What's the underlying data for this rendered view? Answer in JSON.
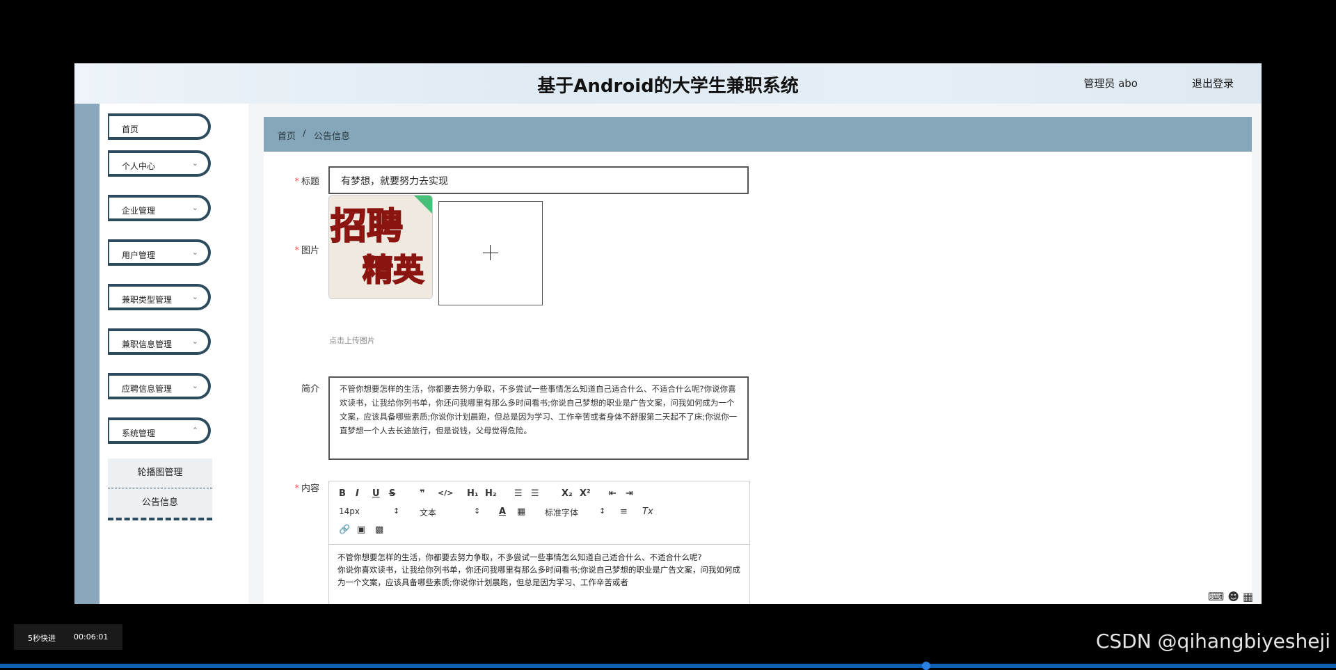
{
  "header": {
    "title": "基于Android的大学生兼职系统",
    "user": "管理员 abo",
    "logout": "退出登录"
  },
  "sidebar": {
    "items": [
      {
        "label": "首页"
      },
      {
        "label": "个人中心"
      },
      {
        "label": "企业管理"
      },
      {
        "label": "用户管理"
      },
      {
        "label": "兼职类型管理"
      },
      {
        "label": "兼职信息管理"
      },
      {
        "label": "应聘信息管理"
      },
      {
        "label": "系统管理"
      }
    ],
    "subitems": [
      {
        "label": "轮播图管理"
      },
      {
        "label": "公告信息"
      }
    ]
  },
  "breadcrumb": {
    "home": "首页",
    "sep": "/",
    "current": "公告信息"
  },
  "form": {
    "title_label": "标题",
    "title_value": "有梦想，就要努力去实现",
    "image_label": "图片",
    "image_text_line1": "招聘",
    "image_text_line2": "精英",
    "upload_tip": "点击上传图片",
    "intro_label": "简介",
    "intro_value": "不管你想要怎样的生活，你都要去努力争取，不多尝试一些事情怎么知道自己适合什么、不适合什么呢?你说你喜欢读书，让我给你列书单，你还问我哪里有那么多时间看书;你说自己梦想的职业是广告文案，问我如何成为一个文案，应该具备哪些素质;你说你计划晨跑，但总是因为学习、工作辛苦或者身体不舒服第二天起不了床;你说你一直梦想一个人去长途旅行，但是说钱，父母觉得危险。",
    "content_label": "内容",
    "toolbar": {
      "bold": "B",
      "italic": "I",
      "underline": "U",
      "strike": "S",
      "quote": "❞",
      "code": "</>",
      "h1": "H₁",
      "h2": "H₂",
      "ol": "☰",
      "ul": "☰",
      "sub": "X₂",
      "sup": "X²",
      "outdent": "⇤",
      "indent": "⇥",
      "size": "14px",
      "type": "文本",
      "font": "标准字体",
      "clear": "Tx"
    },
    "content_line1": "不管你想要怎样的生活，你都要去努力争取，不多尝试一些事情怎么知道自己适合什么、不适合什么呢?",
    "content_line2": "你说你喜欢读书，让我给你列书单，你还问我哪里有那么多时间看书;你说自己梦想的职业是广告文案，问我如何成为一个文案，应该具备哪些素质;你说你计划晨跑，但总是因为学习、工作辛苦或者"
  },
  "overlay": {
    "speed": "5秒快进",
    "time": "00:06:01"
  },
  "watermark": "CSDN @qihangbiyesheji",
  "colors": {
    "sidebar_strip": "#8aa7bb",
    "breadcrumb": "#86a6b9",
    "menu_border": "#2d4b5e",
    "required": "#e55555"
  }
}
